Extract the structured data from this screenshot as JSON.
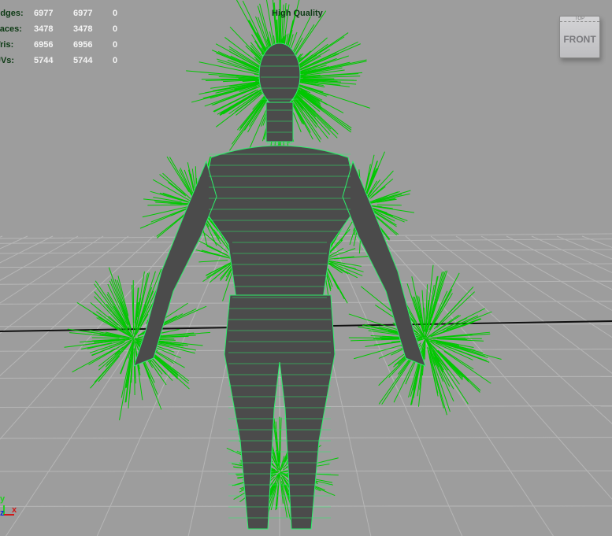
{
  "hud": {
    "quality_label": "High Quality",
    "stats": [
      {
        "label": "Edges:",
        "values": [
          "6977",
          "6977",
          "0"
        ]
      },
      {
        "label": "Faces:",
        "values": [
          "3478",
          "3478",
          "0"
        ]
      },
      {
        "label": "Tris:",
        "values": [
          "6956",
          "6956",
          "0"
        ]
      },
      {
        "label": "UVs:",
        "values": [
          "5744",
          "5744",
          "0"
        ]
      }
    ]
  },
  "view_cube": {
    "top_label": "TOP",
    "face_label": "FRONT"
  },
  "axis_gizmo": {
    "x": "x",
    "y": "y",
    "z": "z"
  },
  "colors": {
    "background": "#9d9d9d",
    "wireframe": "#22ee55",
    "normals": "#00c800",
    "grid": "#b4b4b4",
    "mesh": "#4a4a4a"
  }
}
